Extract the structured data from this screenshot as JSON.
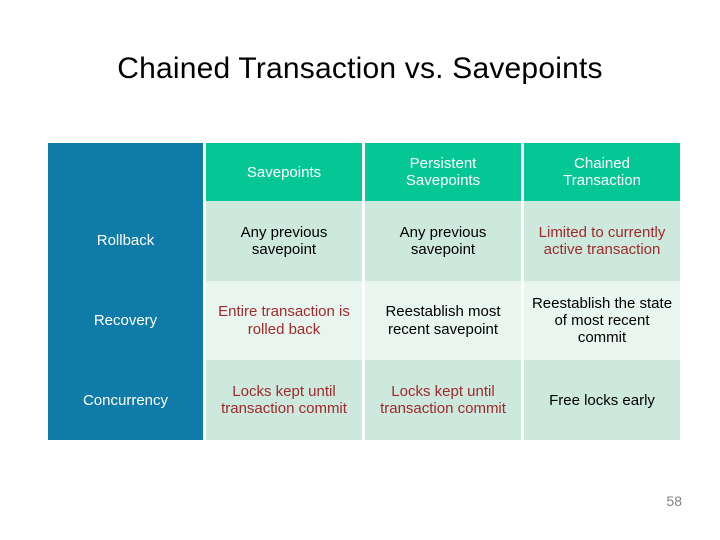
{
  "slide": {
    "title": "Chained Transaction  vs.  Savepoints",
    "page_number": "58"
  },
  "colors": {
    "header_blue": "#0E7BA8",
    "header_green": "#05C795",
    "cell_band_dark": "#CDE8DC",
    "cell_band_light": "#E9F5EF",
    "warn_text": "#9E2A2B",
    "normal_text": "#000000",
    "header_text": "#FFFFFF",
    "page_number_text": "#808080"
  },
  "table": {
    "columns": [
      {
        "label": ""
      },
      {
        "label": "Savepoints"
      },
      {
        "label": "Persistent\nSavepoints"
      },
      {
        "label": "Chained\nTransaction"
      }
    ],
    "header": {
      "blank": "",
      "savepoints": "Savepoints",
      "persistent_savepoints_line1": "Persistent",
      "persistent_savepoints_line2": "Savepoints",
      "chained_transaction_line1": "Chained",
      "chained_transaction_line2": "Transaction"
    },
    "rows": [
      {
        "label": "Rollback",
        "savepoints": "Any previous savepoint",
        "persistent_savepoints": "Any previous savepoint",
        "chained_transaction": "Limited to currently active transaction",
        "highlight": [
          "chained_transaction"
        ]
      },
      {
        "label": "Recovery",
        "savepoints": "Entire transaction is rolled back",
        "persistent_savepoints": "Reestablish most recent savepoint",
        "chained_transaction": "Reestablish the state of most recent commit",
        "highlight": [
          "savepoints"
        ]
      },
      {
        "label": "Concurrency",
        "savepoints": "Locks kept until transaction commit",
        "persistent_savepoints": "Locks kept until transaction commit",
        "chained_transaction": "Free locks early",
        "highlight": [
          "savepoints",
          "persistent_savepoints"
        ]
      }
    ]
  }
}
